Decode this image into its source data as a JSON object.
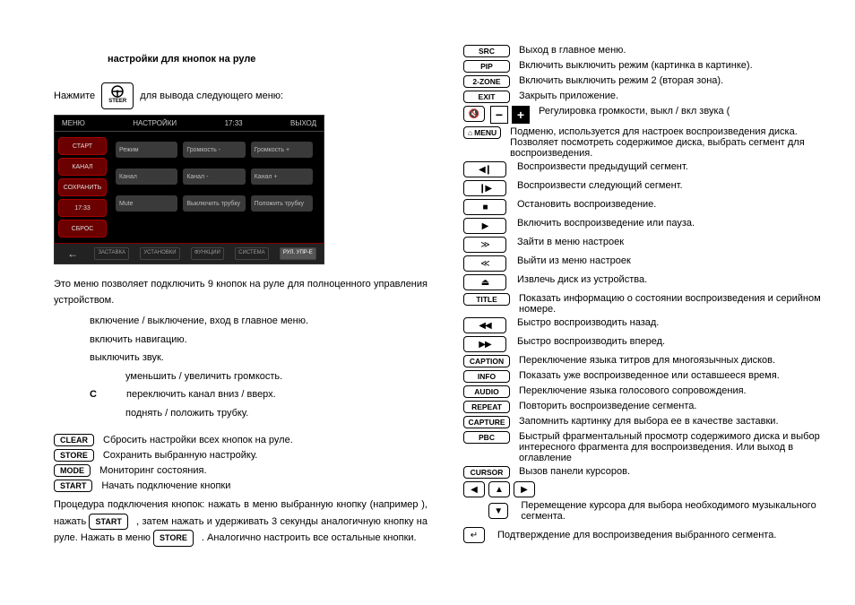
{
  "left": {
    "title": "настройки для кнопок на руле",
    "press": "Нажмите",
    "steer_label": "STEER",
    "press_after": "для вывода следующего меню:",
    "screenshot": {
      "menu": "МЕНЮ",
      "settings": "НАСТРОЙКИ",
      "time": "17:33",
      "exit": "ВЫХОД",
      "side": [
        "СТАРТ",
        "КАНАЛ",
        "СОХРАНИТЬ",
        "17:33",
        "СБРОС"
      ],
      "rows": [
        [
          "Режим",
          "Громкость -",
          "Громкость +"
        ],
        [
          "Канал",
          "Канал -",
          "Канал +"
        ],
        [
          "Mute",
          "Выключить трубку",
          "Положить трубку"
        ]
      ],
      "tabs": [
        "ЗАСТАВКА",
        "УСТАНОВКИ",
        "ФУНКЦИИ",
        "СИСТЕМА",
        "РУЛ. УПР-Е"
      ]
    },
    "intro": "Это меню позволяет подключить 9 кнопок на руле для полноценного управления устройством.",
    "bullets": [
      "включение / выключение, вход в главное меню.",
      "включить           навигацию.",
      "выключить звук.",
      "уменьшить / увеличить громкость.",
      "переключить канал вниз / вверх.",
      "поднять / положить трубку."
    ],
    "c_label": "C",
    "labeled": [
      {
        "btn": "CLEAR",
        "txt": "Сбросить настройки всех кнопок на руле."
      },
      {
        "btn": "STORE",
        "txt": "Сохранить выбранную настройку."
      },
      {
        "btn": "MODE",
        "txt": "Мониторинг состояния."
      },
      {
        "btn": "START",
        "txt": "Начать подключение кнопки"
      }
    ],
    "proc1": "Процедура подключения кнопок: нажать в меню выбранную кнопку (например        ), нажать ",
    "proc_start": "START",
    "proc2": ", затем нажать и удерживать 3 секунды аналогичную кнопку на руле. Нажать в меню ",
    "proc_store": "STORE",
    "proc3": " . Аналогично настроить все остальные кнопки."
  },
  "right": {
    "rows": [
      {
        "type": "lbl",
        "lbl": "SRC",
        "txt": "Выход в главное меню."
      },
      {
        "type": "lbl",
        "lbl": "PIP",
        "txt": "Включить    выключить   режим         (картинка в картинке)."
      },
      {
        "type": "lbl",
        "lbl": "2-ZONE",
        "txt": "Включить    выключить   режим 2             (вторая зона)."
      },
      {
        "type": "lbl",
        "lbl": "EXIT",
        "txt": "Закрыть приложение."
      },
      {
        "type": "vol",
        "txt": "Регулировка громкости, выкл / вкл звука ("
      },
      {
        "type": "menu",
        "txt": "Подменю, используется для настроек воспроизведения диска. Позволяет посмотреть содержимое диска, выбрать сегмент для воспроизведения."
      },
      {
        "type": "icon",
        "glyph": "◀❙",
        "txt": "Воспроизвести предыдущий сегмент."
      },
      {
        "type": "icon",
        "glyph": "❙▶",
        "txt": "Воспроизвести следующий сегмент."
      },
      {
        "type": "icon",
        "glyph": "■",
        "txt": "Остановить воспроизведение."
      },
      {
        "type": "icon",
        "glyph": "▶",
        "txt": "Включить воспроизведение или пауза."
      },
      {
        "type": "icon",
        "glyph": "≫",
        "txt": "Зайти в меню настроек"
      },
      {
        "type": "icon",
        "glyph": "≪",
        "txt": "Выйти из меню настроек"
      },
      {
        "type": "icon",
        "glyph": "⏏",
        "txt": "Извлечь диск из устройства."
      },
      {
        "type": "lbl",
        "lbl": "TITLE",
        "txt": "Показать информацию о состоянии воспроизведения и серийном номере."
      },
      {
        "type": "icon",
        "glyph": "◀◀",
        "txt": "Быстро воспроизводить назад."
      },
      {
        "type": "icon",
        "glyph": "▶▶",
        "txt": "Быстро воспроизводить вперед."
      },
      {
        "type": "lbl",
        "lbl": "CAPTION",
        "txt": "Переключение языка титров для многоязычных дисков."
      },
      {
        "type": "lbl",
        "lbl": "INFO",
        "txt": "Показать уже воспроизведенное или оставшееся время."
      },
      {
        "type": "lbl",
        "lbl": "AUDIO",
        "txt": "Переключение языка голосового сопровождения."
      },
      {
        "type": "lbl",
        "lbl": "REPEAT",
        "txt": "Повторить воспроизведение сегмента."
      },
      {
        "type": "lbl",
        "lbl": "CAPTURE",
        "txt": "Запомнить картинку для выбора ее в качестве заставки."
      },
      {
        "type": "lbl",
        "lbl": "PBC",
        "txt": "Быстрый фрагментальный просмотр содержимого               диска и выбор интересного фрагмента для воспроизведения. Или выход в оглавление"
      },
      {
        "type": "lbl",
        "lbl": "CURSOR",
        "txt": "Вызов панели курсоров."
      }
    ],
    "dpad_txt": "Перемещение курсора для выбора необходимого музыкального сегмента.",
    "enter_txt": "Подтверждение для воспроизведения выбранного сегмента.",
    "menu_label": "MENU"
  }
}
